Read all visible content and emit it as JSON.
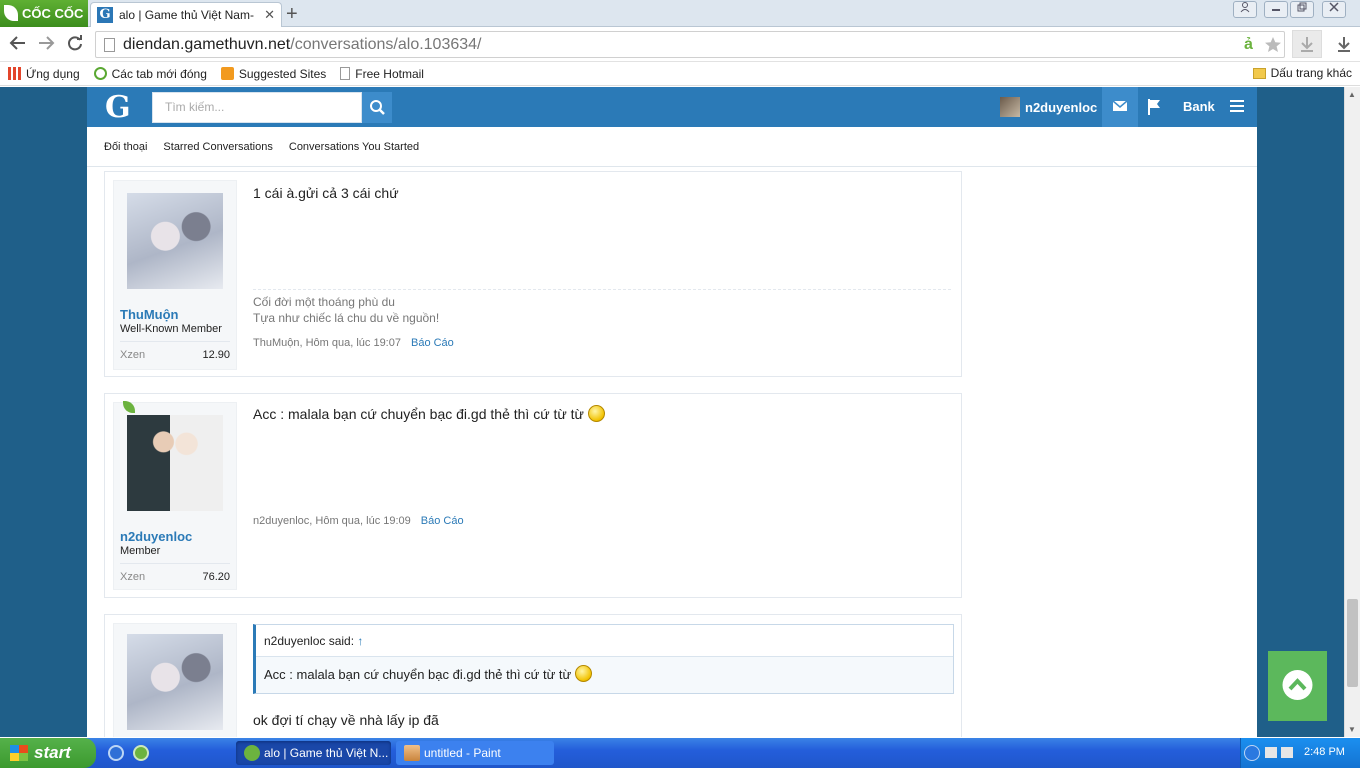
{
  "browser": {
    "brand": "CỐC CỐC",
    "tab_title": "alo | Game thủ Việt Nam- MU",
    "tab_close": "✕",
    "new_tab": "+",
    "url_host": "diendan.gamethuvn.net",
    "url_path": "/conversations/alo.103634/",
    "bookmarks": [
      "Ứng dụng",
      "Các tab mới đóng",
      "Suggested Sites",
      "Free Hotmail"
    ],
    "other_bookmarks": "Dấu trang khác"
  },
  "site": {
    "logo": "G",
    "search_placeholder": "Tìm kiếm...",
    "username": "n2duyenloc",
    "bank_label": "Bank",
    "subnav": [
      "Đối thoại",
      "Starred Conversations",
      "Conversations You Started"
    ]
  },
  "posts": [
    {
      "author": "ThuMuộn",
      "title": "Well-Known Member",
      "xzen_label": "Xzen",
      "xzen": "12.90",
      "message": "1 cái à.gửi cả 3 cái chứ",
      "signature": [
        "Cối đời một thoáng phù du",
        "Tựa như chiếc lá chu du về nguồn!"
      ],
      "meta": "ThuMuộn, Hôm qua, lúc 19:07",
      "report": "Báo Cáo"
    },
    {
      "author": "n2duyenloc",
      "title": "Member",
      "xzen_label": "Xzen",
      "xzen": "76.20",
      "message": "Acc : malala bạn cứ chuyển bạc đi.gd thẻ thì cứ từ từ",
      "meta": "n2duyenloc, Hôm qua, lúc 19:09",
      "report": "Báo Cáo"
    },
    {
      "quote_author": "n2duyenloc said:",
      "quote_text": "Acc : malala bạn cứ chuyển bạc đi.gd thẻ thì cứ từ từ",
      "message": "ok đợi tí chạy về nhà lấy ip đã"
    }
  ],
  "taskbar": {
    "start": "start",
    "tasks": [
      "alo | Game thủ Việt N...",
      "untitled - Paint"
    ],
    "clock": "2:48 PM"
  },
  "colors": {
    "header_blue": "#2b7ab7",
    "page_bg": "#1f5f89",
    "back_to_top": "#5cb85c"
  },
  "icons": {
    "back": "arrow-left-icon",
    "forward": "arrow-right-icon",
    "reload": "reload-icon",
    "search": "magnifier-icon",
    "inbox": "envelope-icon",
    "alerts": "flag-icon",
    "menu": "hamburger-icon",
    "back_to_top": "chevron-up-icon"
  }
}
